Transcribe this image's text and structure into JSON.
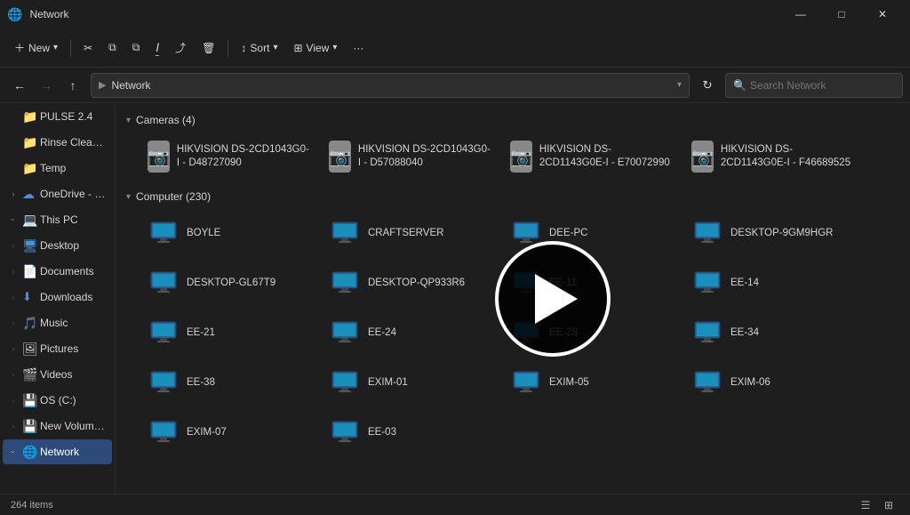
{
  "titleBar": {
    "title": "Network",
    "iconUnicode": "🌐",
    "minimizeLabel": "—",
    "maximizeLabel": "□",
    "closeLabel": "✕"
  },
  "toolbar": {
    "newLabel": "New",
    "cutIcon": "✂",
    "copyIcon": "⧉",
    "pasteIcon": "📋",
    "renameIcon": "T",
    "shareIcon": "⤴",
    "deleteIcon": "🗑",
    "sortLabel": "Sort",
    "viewLabel": "View",
    "moreIcon": "···"
  },
  "addressBar": {
    "backIcon": "←",
    "forwardIcon": "→",
    "upIcon": "↑",
    "breadcrumb": "Network",
    "searchPlaceholder": "Search Network",
    "refreshIcon": "↻"
  },
  "sidebar": {
    "items": [
      {
        "id": "pulse",
        "label": "PULSE 2.4",
        "icon": "📁",
        "type": "folder",
        "indent": 0,
        "hasArrow": false
      },
      {
        "id": "rinse",
        "label": "Rinse Cleaning",
        "icon": "📁",
        "type": "folder",
        "indent": 0,
        "hasArrow": false
      },
      {
        "id": "temp",
        "label": "Temp",
        "icon": "📁",
        "type": "folder",
        "indent": 0,
        "hasArrow": false
      },
      {
        "id": "onedrive",
        "label": "OneDrive - Perso",
        "icon": "☁",
        "type": "cloud",
        "indent": 0,
        "hasArrow": true,
        "groupToggle": true
      },
      {
        "id": "thispc",
        "label": "This PC",
        "icon": "💻",
        "type": "pc",
        "indent": 0,
        "hasArrow": true,
        "groupToggle": true
      },
      {
        "id": "desktop",
        "label": "Desktop",
        "icon": "🖥",
        "type": "folder-blue",
        "indent": 1,
        "hasArrow": true
      },
      {
        "id": "documents",
        "label": "Documents",
        "icon": "📄",
        "type": "folder-blue",
        "indent": 1,
        "hasArrow": true
      },
      {
        "id": "downloads",
        "label": "Downloads",
        "icon": "⬇",
        "type": "folder-blue",
        "indent": 1,
        "hasArrow": true
      },
      {
        "id": "music",
        "label": "Music",
        "icon": "🎵",
        "type": "folder-blue",
        "indent": 1,
        "hasArrow": true
      },
      {
        "id": "pictures",
        "label": "Pictures",
        "icon": "🖼",
        "type": "folder-blue",
        "indent": 1,
        "hasArrow": true
      },
      {
        "id": "videos",
        "label": "Videos",
        "icon": "🎬",
        "type": "folder-blue",
        "indent": 1,
        "hasArrow": true
      },
      {
        "id": "osc",
        "label": "OS (C:)",
        "icon": "💾",
        "type": "drive",
        "indent": 1,
        "hasArrow": true
      },
      {
        "id": "newvolume",
        "label": "New Volume (D",
        "icon": "💾",
        "type": "drive",
        "indent": 1,
        "hasArrow": true
      },
      {
        "id": "network",
        "label": "Network",
        "icon": "🌐",
        "type": "network",
        "indent": 0,
        "hasArrow": true,
        "active": true
      }
    ]
  },
  "content": {
    "sections": [
      {
        "id": "cameras",
        "title": "Cameras (4)",
        "items": [
          {
            "name": "HIKVISION DS-2CD1043G0-I - D48727090",
            "type": "camera"
          },
          {
            "name": "HIKVISION DS-2CD1043G0-I - D57088040",
            "type": "camera"
          },
          {
            "name": "HIKVISION DS-2CD1143G0E-I - E70072990",
            "type": "camera"
          },
          {
            "name": "HIKVISION DS-2CD1143G0E-I - F46689525",
            "type": "camera"
          }
        ]
      },
      {
        "id": "computers",
        "title": "Computer (230)",
        "items": [
          {
            "name": "BOYLE",
            "type": "computer"
          },
          {
            "name": "CRAFTSERVER",
            "type": "computer"
          },
          {
            "name": "DEE-PC",
            "type": "computer"
          },
          {
            "name": "DESKTOP-9GM9HGR",
            "type": "computer"
          },
          {
            "name": "DESKTOP-GL67T9",
            "type": "computer"
          },
          {
            "name": "DESKTOP-QP933R6",
            "type": "computer"
          },
          {
            "name": "EE-11",
            "type": "computer"
          },
          {
            "name": "EE-14",
            "type": "computer"
          },
          {
            "name": "EE-21",
            "type": "computer"
          },
          {
            "name": "EE-24",
            "type": "computer"
          },
          {
            "name": "EE-28",
            "type": "computer"
          },
          {
            "name": "EE-34",
            "type": "computer"
          },
          {
            "name": "EE-38",
            "type": "computer"
          },
          {
            "name": "EXIM-01",
            "type": "computer"
          },
          {
            "name": "EXIM-05",
            "type": "computer"
          },
          {
            "name": "EXIM-06",
            "type": "computer"
          },
          {
            "name": "EXIM-07",
            "type": "computer"
          },
          {
            "name": "EE-03",
            "type": "computer"
          }
        ]
      }
    ]
  },
  "statusBar": {
    "itemCount": "264 items",
    "listViewIcon": "☰",
    "gridViewIcon": "⊞"
  }
}
